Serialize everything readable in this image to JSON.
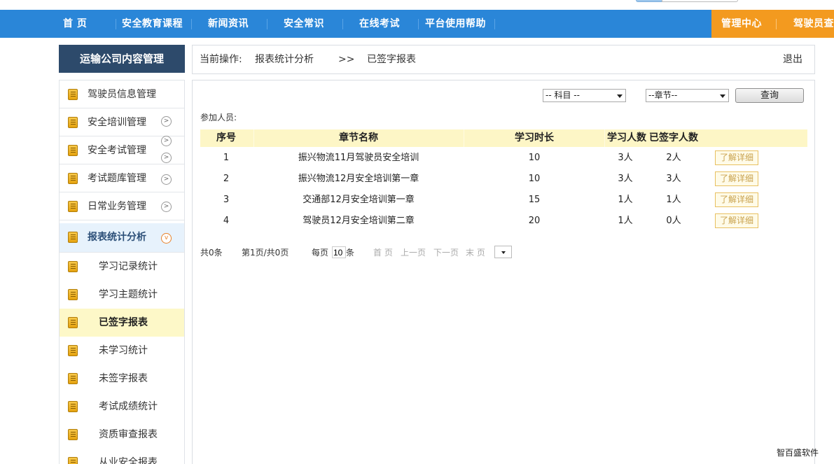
{
  "nav": {
    "items": [
      "首 页",
      "安全教育课程",
      "新闻资讯",
      "安全常识",
      "在线考试",
      "平台使用帮助"
    ],
    "right_items": [
      "管理中心",
      "驾驶员查"
    ]
  },
  "sidebar": {
    "title": "运输公司内容管理",
    "items": [
      {
        "label": "驾驶员信息管理"
      },
      {
        "label": "安全培训管理"
      },
      {
        "label": "安全考试管理"
      },
      {
        "label": "考试题库管理"
      },
      {
        "label": "日常业务管理"
      },
      {
        "label": "报表统计分析"
      }
    ],
    "sub_items": [
      {
        "label": "学习记录统计"
      },
      {
        "label": "学习主题统计"
      },
      {
        "label": "已签字报表"
      },
      {
        "label": "未学习统计"
      },
      {
        "label": "未签字报表"
      },
      {
        "label": "考试成绩统计"
      },
      {
        "label": "资质审查报表"
      },
      {
        "label": "从业安全报表"
      }
    ]
  },
  "breadcrumb": {
    "prefix": "当前操作:",
    "section": "报表统计分析",
    "separator": ">>",
    "current": "已签字报表",
    "logout": "退出"
  },
  "filters": {
    "subject": "-- 科目 --",
    "chapter": "--章节--",
    "query_label": "查询"
  },
  "participants_label": "参加人员:",
  "table": {
    "headers": [
      "序号",
      "章节名称",
      "学习时长",
      "学习人数",
      "已签字人数"
    ],
    "rows": [
      {
        "no": "1",
        "name": "振兴物流11月驾驶员安全培训",
        "duration": "10",
        "learners": "3人",
        "signed": "2人",
        "action": "了解详细"
      },
      {
        "no": "2",
        "name": "振兴物流12月安全培训第一章",
        "duration": "10",
        "learners": "3人",
        "signed": "3人",
        "action": "了解详细"
      },
      {
        "no": "3",
        "name": "交通部12月安全培训第一章",
        "duration": "15",
        "learners": "1人",
        "signed": "1人",
        "action": "了解详细"
      },
      {
        "no": "4",
        "name": "驾驶员12月安全培训第二章",
        "duration": "20",
        "learners": "1人",
        "signed": "0人",
        "action": "了解详细"
      }
    ]
  },
  "pager": {
    "total": "共0条",
    "page_info": "第1页/共0页",
    "per_page_label": "每页",
    "per_page_value": "10",
    "per_page_unit": "条",
    "first": "首 页",
    "prev": "上一页",
    "next": "下一页",
    "last": "末 页"
  },
  "watermark": "智百盛软件",
  "colors": {
    "nav_blue": "#2a86d8",
    "nav_orange": "#f39a1f",
    "sidebar_title_bg": "#2d4a6b",
    "table_header_bg": "#fdf6c6",
    "active_sub_bg": "#fdf8c8"
  }
}
